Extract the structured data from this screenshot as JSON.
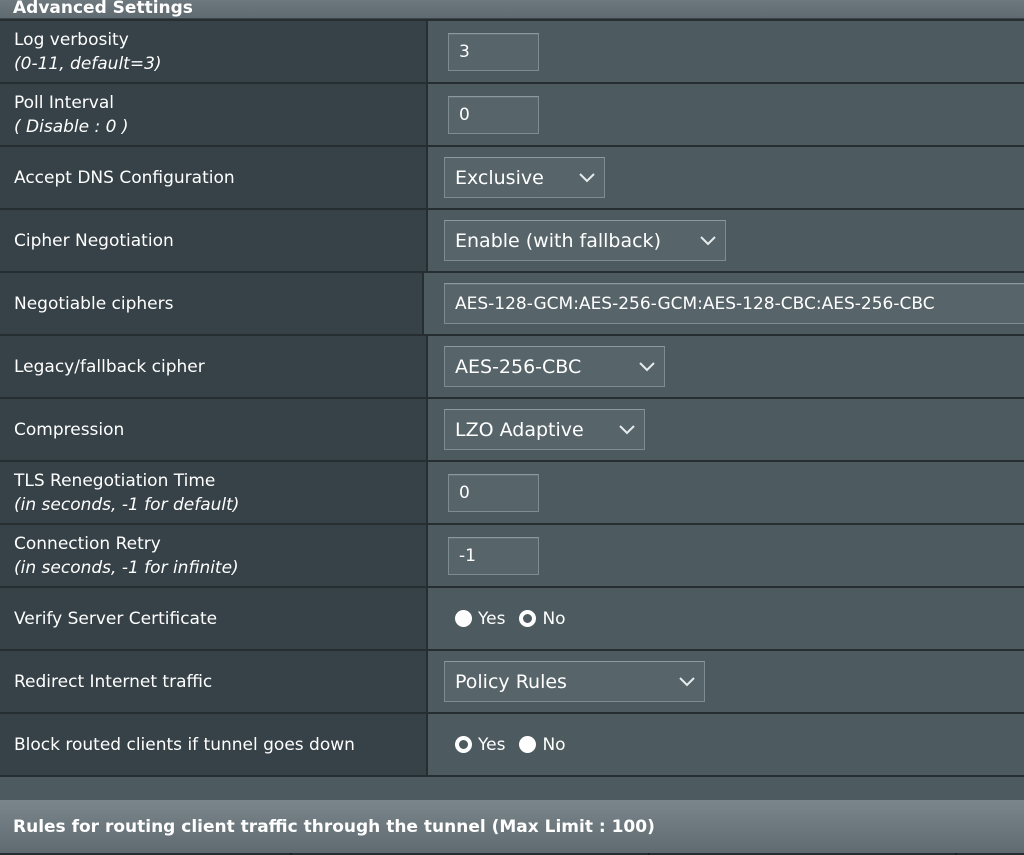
{
  "section_title": "Advanced Settings",
  "rows": {
    "log_verbosity": {
      "label": "Log verbosity",
      "hint": "(0-11, default=3)",
      "value": "3"
    },
    "poll_interval": {
      "label": "Poll Interval",
      "hint": "( Disable : 0 )",
      "value": "0"
    },
    "accept_dns": {
      "label": "Accept DNS Configuration",
      "value": "Exclusive"
    },
    "cipher_negotiation": {
      "label": "Cipher Negotiation",
      "value": "Enable (with fallback)"
    },
    "negotiable_ciphers": {
      "label": "Negotiable ciphers",
      "value": "AES-128-GCM:AES-256-GCM:AES-128-CBC:AES-256-CBC"
    },
    "legacy_cipher": {
      "label": "Legacy/fallback cipher",
      "value": "AES-256-CBC"
    },
    "compression": {
      "label": "Compression",
      "value": "LZO Adaptive"
    },
    "tls_renegotiation": {
      "label": "TLS Renegotiation Time",
      "hint": "(in seconds, -1 for default)",
      "value": "0"
    },
    "connection_retry": {
      "label": "Connection Retry",
      "hint": "(in seconds, -1 for infinite)",
      "value": "-1"
    },
    "verify_server_cert": {
      "label": "Verify Server Certificate",
      "options": [
        "Yes",
        "No"
      ],
      "selected": "No"
    },
    "redirect_internet": {
      "label": "Redirect Internet traffic",
      "value": "Policy Rules"
    },
    "block_routed_clients": {
      "label": "Block routed clients if tunnel goes down",
      "options": [
        "Yes",
        "No"
      ],
      "selected": "Yes"
    }
  },
  "rules_section_title": "Rules for routing client traffic through the tunnel (Max Limit : 100)",
  "icons": {
    "dropdown": "chevron-down-icon",
    "radio_selected": "radio-selected-icon",
    "radio_unselected": "radio-unselected-icon"
  },
  "colors": {
    "background": "#4d5a5f",
    "label_cell": "#364247",
    "border": "#262e31",
    "input_bg": "#57646a",
    "text": "#ffffff"
  }
}
